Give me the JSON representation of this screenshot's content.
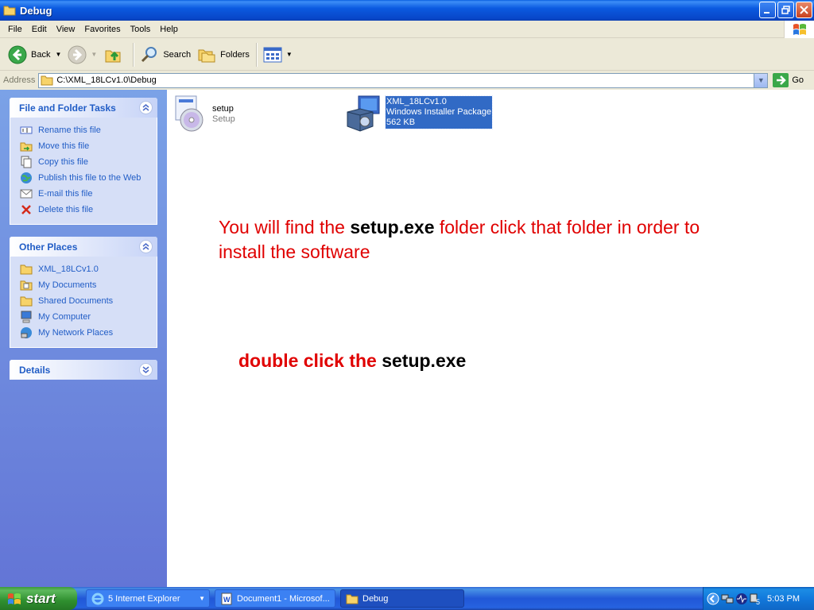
{
  "window": {
    "title": "Debug"
  },
  "menu": [
    "File",
    "Edit",
    "View",
    "Favorites",
    "Tools",
    "Help"
  ],
  "toolbar": {
    "back": "Back",
    "search": "Search",
    "folders": "Folders"
  },
  "address": {
    "label": "Address",
    "path": "C:\\XML_18LCv1.0\\Debug",
    "go": "Go"
  },
  "tasks_panel": {
    "title": "File and Folder Tasks",
    "items": [
      "Rename this file",
      "Move this file",
      "Copy this file",
      "Publish this file to the Web",
      "E-mail this file",
      "Delete this file"
    ]
  },
  "places_panel": {
    "title": "Other Places",
    "items": [
      "XML_18LCv1.0",
      "My Documents",
      "Shared Documents",
      "My Computer",
      "My Network Places"
    ]
  },
  "details_panel": {
    "title": "Details"
  },
  "files": [
    {
      "name": "setup",
      "type": "Setup"
    },
    {
      "name": "XML_18LCv1.0",
      "type": "Windows Installer Package",
      "size": "562 KB"
    }
  ],
  "notes": {
    "line1_a": "You will find the ",
    "line1_b": "setup.exe",
    "line1_c": " folder click that folder in order to install the software",
    "line2_a": "double click the ",
    "line2_b": "setup.exe"
  },
  "taskbar": {
    "start": "start",
    "tasks": [
      "5 Internet Explorer",
      "Document1 - Microsof...",
      "Debug"
    ],
    "clock": "5:03 PM"
  },
  "colors": {
    "title_blue": "#0b5ae0",
    "taskpane_link": "#215dc6",
    "note_red": "#e00000",
    "selection": "#316ac5"
  }
}
